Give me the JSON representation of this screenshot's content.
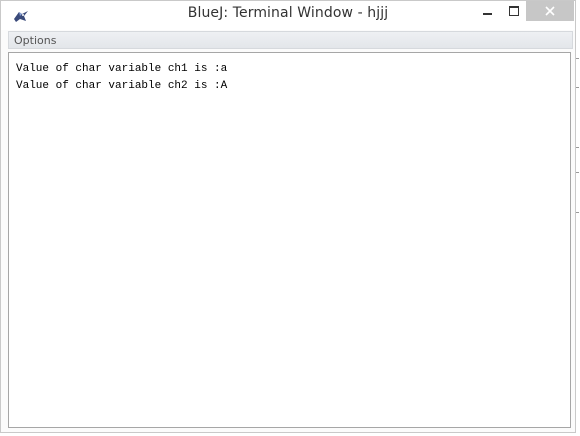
{
  "window": {
    "title": "BlueJ: Terminal Window - hjjj",
    "controls": {
      "minimize_icon": "minimize-icon",
      "maximize_icon": "maximize-icon",
      "close_icon": "close-icon"
    },
    "app_icon": "bluej-bird-icon"
  },
  "menubar": {
    "items": [
      {
        "label": "Options"
      }
    ]
  },
  "terminal": {
    "lines": [
      "Value of char variable ch1 is :a",
      "Value of char variable ch2 is :A"
    ]
  },
  "colors": {
    "close_button_bg": "#c7c7c7",
    "terminal_bg": "#ffffff",
    "text": "#000000"
  }
}
